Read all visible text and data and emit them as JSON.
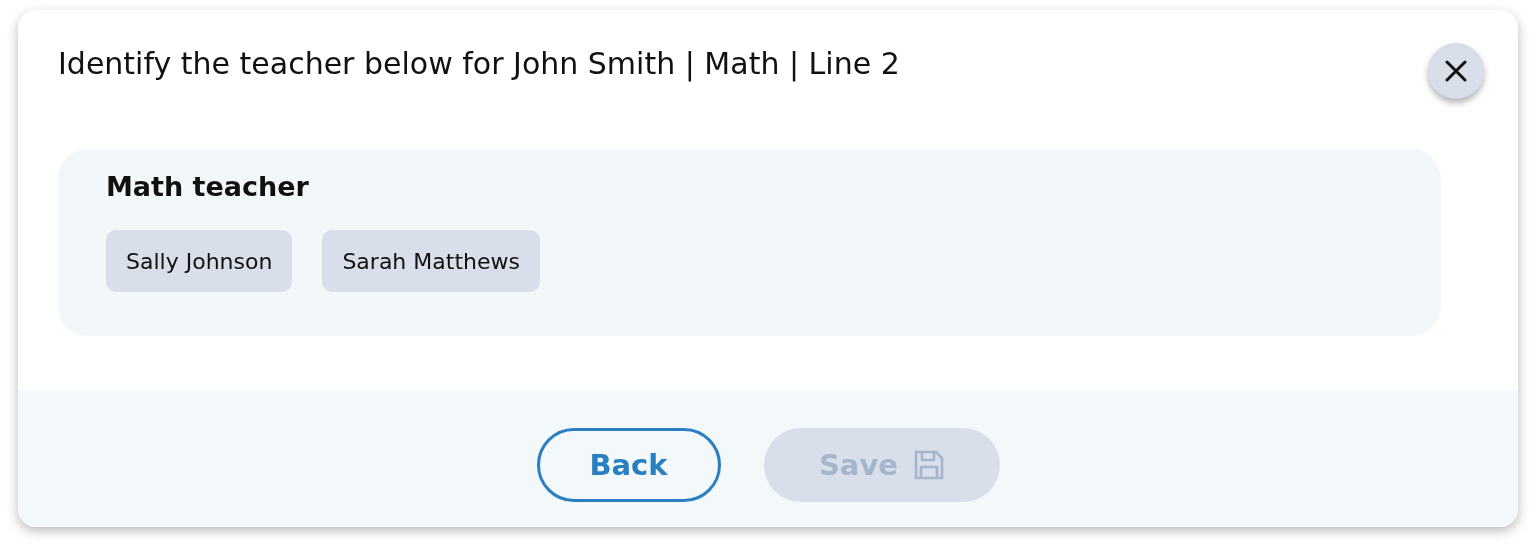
{
  "dialog": {
    "title": "Identify the teacher below for John Smith | Math | Line 2"
  },
  "group": {
    "heading": "Math teacher",
    "options": [
      {
        "label": "Sally Johnson",
        "selected": false
      },
      {
        "label": "Sarah Matthews",
        "selected": false
      }
    ]
  },
  "buttons": [
    {
      "label": "Back",
      "kind": "outline",
      "disabled": false
    },
    {
      "label": "Save",
      "kind": "save",
      "disabled": true
    }
  ]
}
